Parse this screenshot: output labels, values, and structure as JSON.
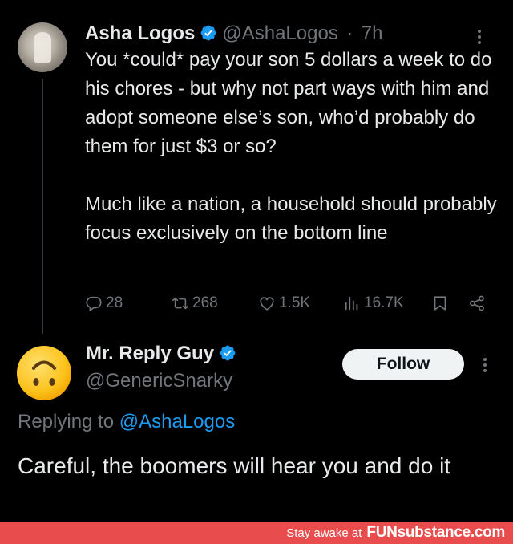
{
  "tweet": {
    "author_name": "Asha Logos",
    "handle": "@AshaLogos",
    "separator": "·",
    "time": "7h",
    "body_paragraphs": [
      "You *could* pay your son 5 dollars a week to do his chores - but why not part ways with him and adopt someone else’s son, who’d probably do them for just $3 or so?",
      "Much like a nation, a household should probably focus exclusively on the bottom line"
    ],
    "actions": {
      "replies": "28",
      "retweets": "268",
      "likes": "1.5K",
      "views": "16.7K"
    }
  },
  "reply": {
    "author_name": "Mr. Reply Guy",
    "handle": "@GenericSnarky",
    "follow_label": "Follow",
    "replying_prefix": "Replying to",
    "replying_mention": "@AshaLogos",
    "body": "Careful, the boomers will hear you and do it"
  },
  "footer": {
    "tagline": "Stay awake at",
    "brand": "FUNsubstance.com"
  },
  "colors": {
    "background": "#000000",
    "text": "#e7e9ea",
    "muted": "#71767b",
    "verified": "#1d9bf0",
    "link": "#1d9bf0",
    "footer_bg": "#e84c4c"
  },
  "icons": {
    "avatar2": "upside-down-face-emoji",
    "reply": "reply-icon",
    "retweet": "retweet-icon",
    "like": "heart-icon",
    "views": "views-icon",
    "bookmark": "bookmark-icon",
    "share": "share-icon"
  }
}
